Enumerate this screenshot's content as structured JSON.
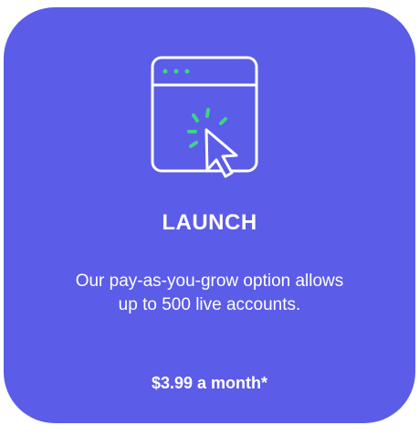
{
  "card": {
    "icon_name": "browser-window-click-icon",
    "title": "LAUNCH",
    "description": "Our pay-as-you-grow option allows up to 500 live accounts.",
    "price": "$3.99 a month*",
    "colors": {
      "background": "#5b5ce8",
      "text": "#ffffff",
      "accent": "#3ed38b"
    }
  }
}
